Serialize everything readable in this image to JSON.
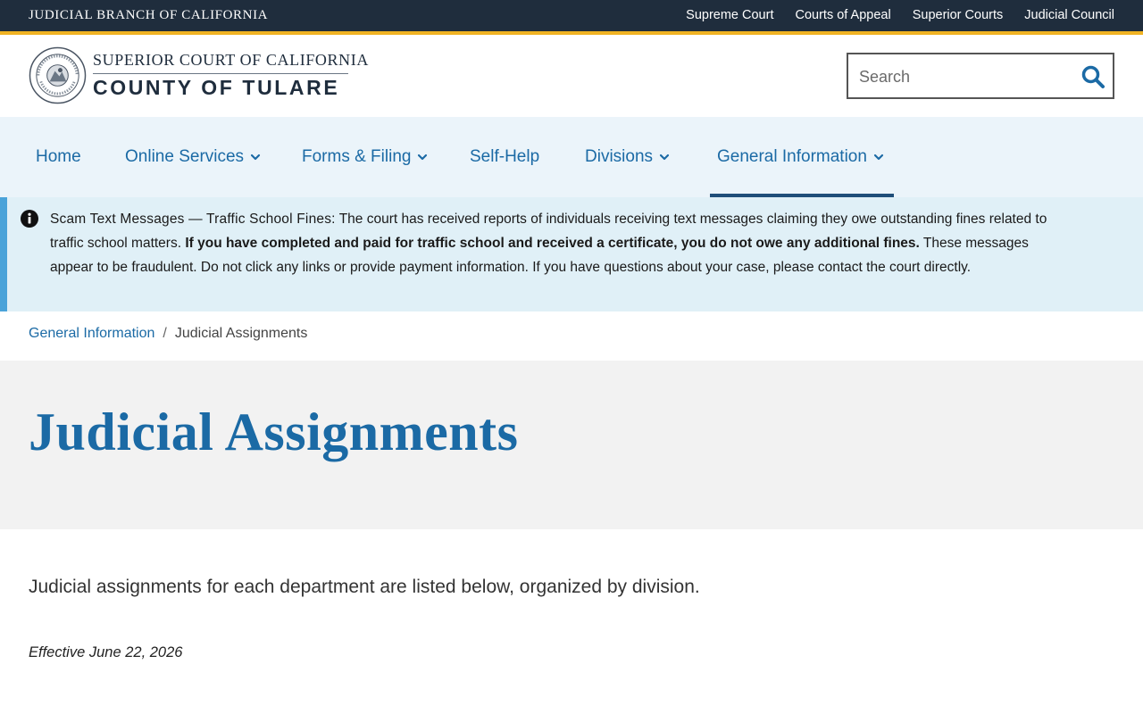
{
  "topbar": {
    "branch_title": "JUDICIAL BRANCH OF CALIFORNIA",
    "links": [
      "Supreme Court",
      "Courts of Appeal",
      "Superior Courts",
      "Judicial Council"
    ]
  },
  "header": {
    "court_line1": "SUPERIOR COURT OF CALIFORNIA",
    "court_line2": "COUNTY OF TULARE",
    "seal_icon": "court-seal-icon",
    "search": {
      "placeholder": "Search",
      "value": "",
      "icon": "search-icon"
    }
  },
  "nav": {
    "items": [
      {
        "label": "Home",
        "has_dropdown": false
      },
      {
        "label": "Online Services",
        "has_dropdown": true
      },
      {
        "label": "Forms & Filing",
        "has_dropdown": true
      },
      {
        "label": "Self-Help",
        "has_dropdown": false
      },
      {
        "label": "Divisions",
        "has_dropdown": true
      },
      {
        "label": "General Information",
        "has_dropdown": true,
        "active": true
      }
    ]
  },
  "alert": {
    "icon": "info-icon",
    "lead": "Scam Text Messages — Traffic School Fines:",
    "text1": " The court has received reports of individuals receiving text messages claiming they owe outstanding fines related to traffic school matters. ",
    "bold": "If you have completed and paid for traffic school and received a certificate, you do not owe any additional fines.",
    "text2": " These messages appear to be fraudulent. Do not click any links or provide payment information. If you have questions about your case, please contact the court directly."
  },
  "breadcrumb": {
    "parent": "General Information",
    "separator": "/",
    "current": "Judicial Assignments"
  },
  "page": {
    "title": "Judicial Assignments",
    "intro": "Judicial assignments for each department are listed below, organized by division.",
    "effective": "Effective June 22, 2026"
  },
  "colors": {
    "topbar": "#1f2d3d",
    "gold_accent": "#f0b323",
    "link_blue": "#1b6aa5",
    "nav_bg": "#ebf4fa",
    "alert_bg": "#e0f0f7",
    "alert_stripe": "#4aa3d9",
    "hero_bg": "#f2f2f2"
  }
}
